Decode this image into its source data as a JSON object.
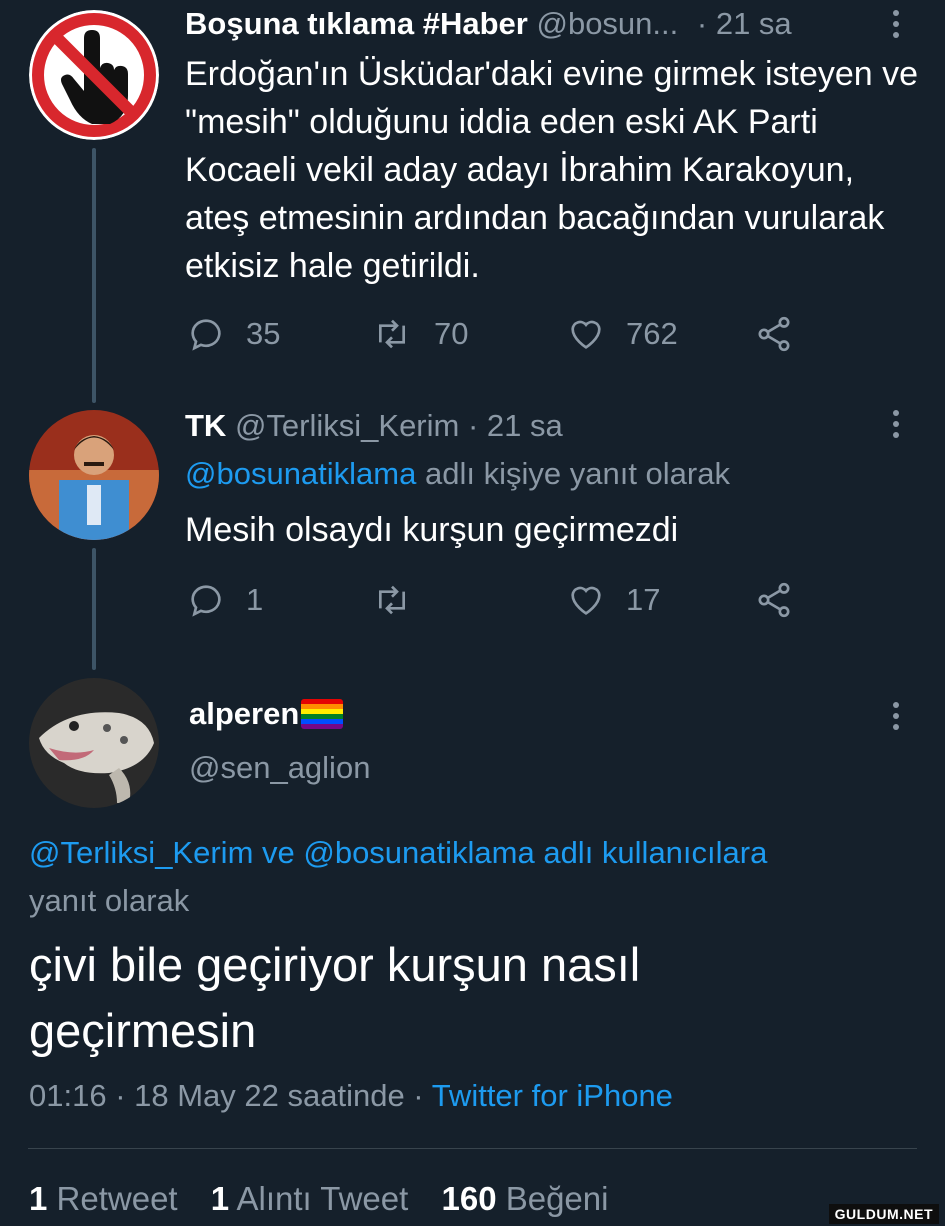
{
  "tweet1": {
    "name": "Boşuna tıklama #Haber",
    "handle": "@bosun...",
    "time": "· 21 sa",
    "text": "Erdoğan'ın Üsküdar'daki evine girmek isteyen ve \"mesih\" olduğunu iddia eden eski AK Parti Kocaeli vekil aday adayı İbrahim Karakoyun, ateş etmesinin ardından bacağından vurularak etkisiz hale getirildi.",
    "replies": "35",
    "retweets": "70",
    "likes": "762"
  },
  "tweet2": {
    "name": "TK",
    "handle": "@Terliksi_Kerim",
    "time": "· 21 sa",
    "reply_to_user": "@bosunatiklama",
    "reply_to_suffix": "adlı kişiye yanıt olarak",
    "text": "Mesih olsaydı kurşun geçirmezdi",
    "replies": "1",
    "likes": "17"
  },
  "main": {
    "name": "alperen",
    "handle": "@sen_aglion",
    "reply_users": "@Terliksi_Kerim ve @bosunatiklama adlı kullanıcılara",
    "reply_suffix": "yanıt olarak",
    "text": "çivi bile geçiriyor kurşun nasıl geçirmesin",
    "timestamp": "01:16 · 18 May 22 saatinde ·",
    "client": "Twitter for iPhone",
    "stats": {
      "retweets_count": "1",
      "retweets_label": "Retweet",
      "quotes_count": "1",
      "quotes_label": "Alıntı Tweet",
      "likes_count": "160",
      "likes_label": "Beğeni"
    }
  },
  "watermark": "GULDUM.NET",
  "colors": {
    "background": "#15202b",
    "accent": "#1d9bf0",
    "muted": "#8b98a5",
    "divider": "#38444d"
  }
}
